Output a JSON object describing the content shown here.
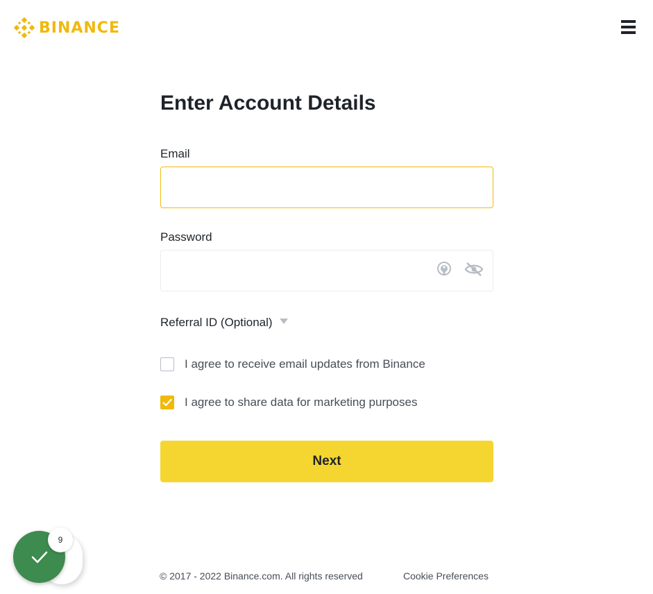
{
  "header": {
    "logo_text": "BINANCE",
    "menu_icon": "hamburger-menu-icon",
    "brand_color": "#f0b90b"
  },
  "form": {
    "title": "Enter Account Details",
    "email": {
      "label": "Email",
      "value": "",
      "placeholder": ""
    },
    "password": {
      "label": "Password",
      "value": "",
      "placeholder": "",
      "icons": [
        "password-manager-icon",
        "eye-off-icon"
      ]
    },
    "referral": {
      "label": "Referral ID (Optional)"
    },
    "checkboxes": [
      {
        "label": "I agree to receive email updates from Binance",
        "checked": false
      },
      {
        "label": "I agree to share data for marketing purposes",
        "checked": true
      }
    ],
    "submit_label": "Next",
    "button_color": "#f5d631"
  },
  "footer": {
    "copyright": "© 2017 - 2022 Binance.com. All rights reserved",
    "cookie_link": "Cookie Preferences"
  },
  "widget": {
    "badge_count": "9",
    "icon": "checkmark-icon",
    "color": "#3d8b4e"
  }
}
